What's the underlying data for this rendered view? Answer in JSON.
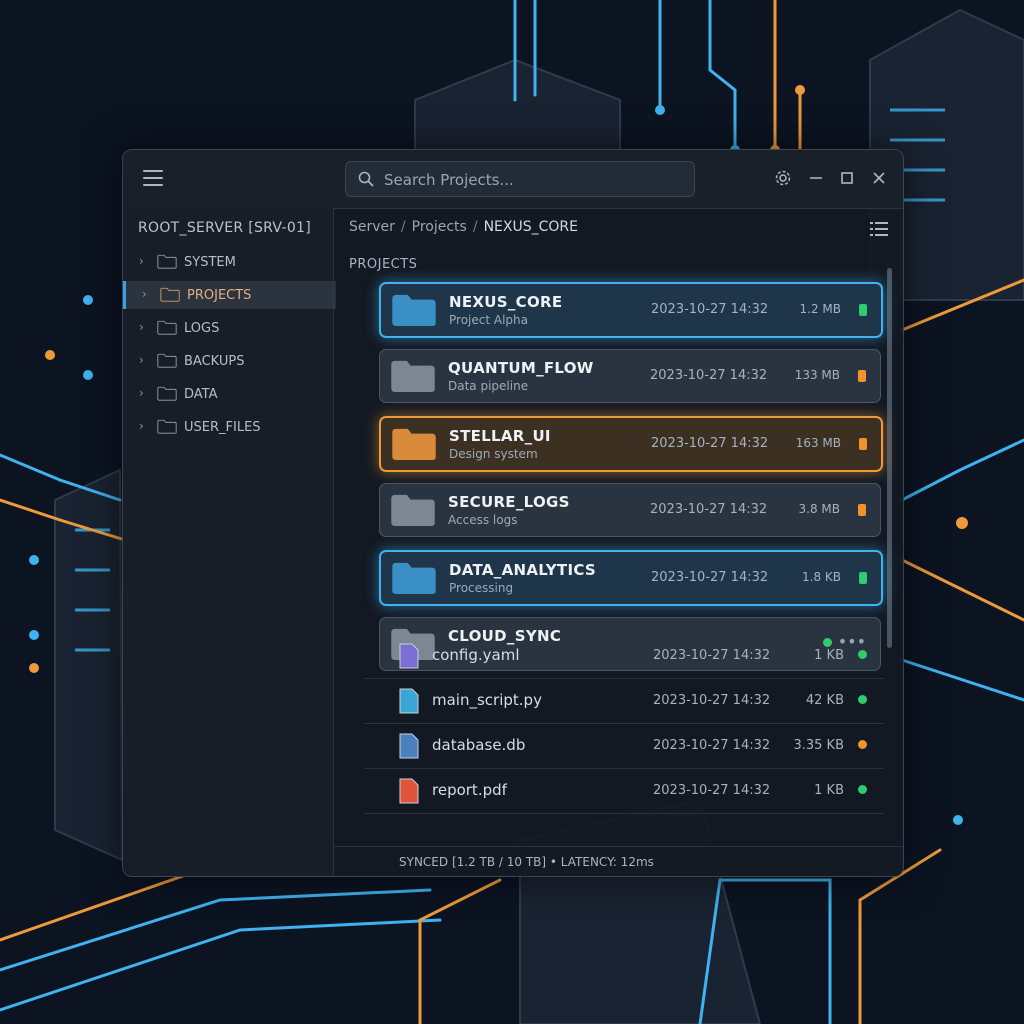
{
  "search": {
    "placeholder": "Search Projects..."
  },
  "sidebar": {
    "server_title": "ROOT_SERVER [SRV-01]",
    "items": [
      {
        "label": "SYSTEM",
        "active": false
      },
      {
        "label": "PROJECTS",
        "active": true
      },
      {
        "label": "LOGS",
        "active": false
      },
      {
        "label": "BACKUPS",
        "active": false
      },
      {
        "label": "DATA",
        "active": false
      },
      {
        "label": "USER_FILES",
        "active": false
      }
    ]
  },
  "breadcrumb": {
    "items": [
      "Server",
      "Projects"
    ],
    "current": "NEXUS_CORE"
  },
  "main": {
    "section_label": "PROJECTS"
  },
  "projects": [
    {
      "name": "NEXUS_CORE",
      "sub": "Project Alpha",
      "date": "2023-10-27 14:32",
      "size": "1.2 MB",
      "accent": "blue",
      "status_color": "#2ecc71"
    },
    {
      "name": "QUANTUM_FLOW",
      "sub": "Data pipeline",
      "date": "2023-10-27 14:32",
      "size": "133 MB",
      "accent": "gray",
      "status_color": "#f0932b"
    },
    {
      "name": "STELLAR_UI",
      "sub": "Design system",
      "date": "2023-10-27 14:32",
      "size": "163 MB",
      "accent": "orange",
      "status_color": "#f0932b"
    },
    {
      "name": "SECURE_LOGS",
      "sub": "Access logs",
      "date": "2023-10-27 14:32",
      "size": "3.8 MB",
      "accent": "gray",
      "status_color": "#f0932b"
    },
    {
      "name": "DATA_ANALYTICS",
      "sub": "Processing",
      "date": "2023-10-27 14:32",
      "size": "1.8 KB",
      "accent": "blue",
      "status_color": "#2ecc71"
    },
    {
      "name": "CLOUD_SYNC",
      "sub": "",
      "date": "",
      "size": "",
      "accent": "gray",
      "status_color": "#2ecc71"
    }
  ],
  "files": [
    {
      "name": "config.yaml",
      "date": "2023-10-27 14:32",
      "size": "1 KB",
      "icon": "code-file-icon",
      "status_color": "#2ecc71"
    },
    {
      "name": "main_script.py",
      "date": "2023-10-27 14:32",
      "size": "42 KB",
      "icon": "python-file-icon",
      "status_color": "#2ecc71"
    },
    {
      "name": "database.db",
      "date": "2023-10-27 14:32",
      "size": "3.35 KB",
      "icon": "database-file-icon",
      "status_color": "#f0932b"
    },
    {
      "name": "report.pdf",
      "date": "2023-10-27 14:32",
      "size": "1 KB",
      "icon": "pdf-file-icon",
      "status_color": "#2ecc71"
    }
  ],
  "status": {
    "text": "SYNCED [1.2 TB / 10 TB] • LATENCY: 12ms"
  },
  "colors": {
    "accent_blue": "#3fb2ef",
    "accent_orange": "#ee9a3a",
    "ok": "#2ecc71",
    "warn": "#f0932b"
  }
}
